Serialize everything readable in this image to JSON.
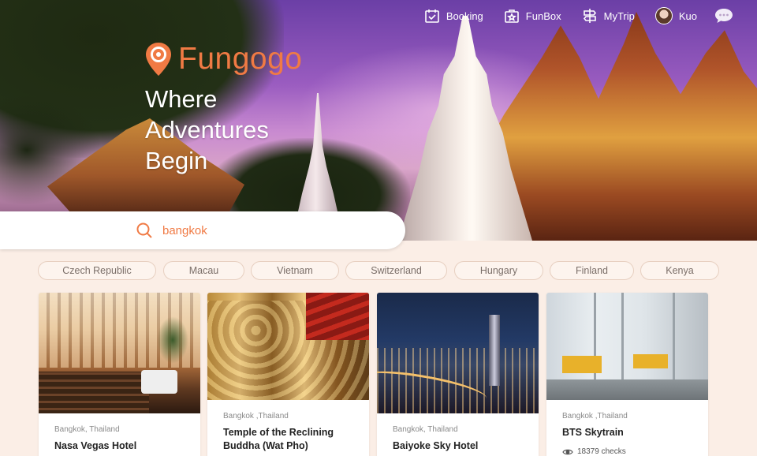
{
  "brand": {
    "name": "Fungogo",
    "color": "#f07a44"
  },
  "tagline": [
    "Where",
    "Adventures",
    "Begin"
  ],
  "nav": {
    "booking": "Booking",
    "funbox": "FunBox",
    "mytrip": "MyTrip",
    "user": "Kuo"
  },
  "search": {
    "value": "bangkok"
  },
  "chips": [
    "Czech Republic",
    "Macau",
    "Vietnam",
    "Switzerland",
    "Hungary",
    "Finland",
    "Kenya"
  ],
  "cards": [
    {
      "location": "Bangkok, Thailand",
      "title": "Nasa Vegas Hotel"
    },
    {
      "location": "Bangkok ,Thailand",
      "title": "Temple of the Reclining Buddha (Wat Pho)"
    },
    {
      "location": "Bangkok, Thailand",
      "title": "Baiyoke Sky Hotel"
    },
    {
      "location": "Bangkok ,Thailand",
      "title": "BTS Skytrain",
      "checks": "18379 checks"
    }
  ]
}
